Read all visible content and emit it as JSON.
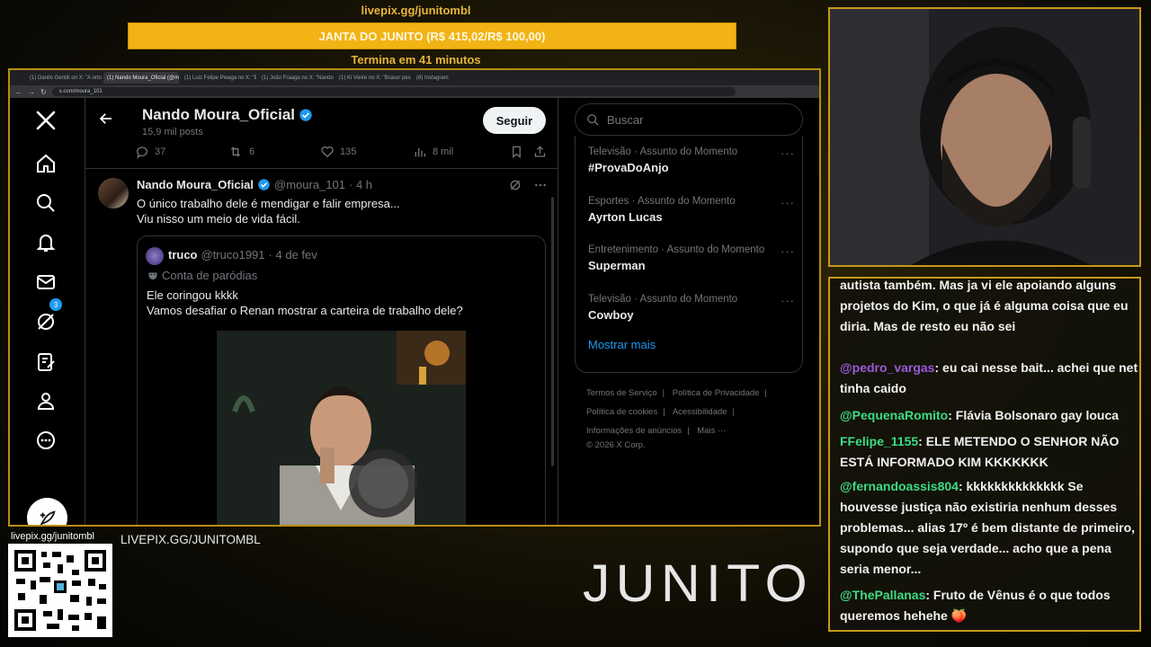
{
  "overlay": {
    "pix_url": "livepix.gg/junitombl",
    "goal_text": "JANTA DO JUNITO (R$ 415,02/R$ 100,00)",
    "goal_timer": "Termina em 41 minutos",
    "qr_label": "livepix.gg/junitombl",
    "pix_bottom": "LIVEPIX.GG/JUNITOMBL",
    "logo_text": "JUNITO"
  },
  "browser": {
    "tabs": [
      {
        "label": "(1) Danilo Gentili on X: \"A orto",
        "active": false
      },
      {
        "label": "(1) Nando Moura_Oficial (@mo",
        "active": true
      },
      {
        "label": "(1) Luiz Felipe Pwaga no X: \"B",
        "active": false
      },
      {
        "label": "(1) João Fraaga no X: \"Nando",
        "active": false
      },
      {
        "label": "(1) Ki Vieire no X: \"Brasor pes",
        "active": false
      },
      {
        "label": "(8) Instagram",
        "active": false
      }
    ],
    "url": "x.com/moura_101"
  },
  "sidebar": {
    "notifications_badge": "3"
  },
  "profile": {
    "name": "Nando Moura_Oficial",
    "posts_count": "15,9 mil posts",
    "follow_label": "Seguir"
  },
  "prev_actions": {
    "replies": "37",
    "reposts": "6",
    "likes": "135",
    "views": "8 mil"
  },
  "tweet": {
    "name": "Nando Moura_Oficial",
    "handle": "@moura_101",
    "time": "· 4 h",
    "line1": "O único trabalho dele é mendigar e falir empresa...",
    "line2": "Viu nisso um meio de vida fácil."
  },
  "quote": {
    "name": "truco",
    "handle": "@truco1991",
    "date": "· 4 de fev",
    "parody_label": "Conta de paródias",
    "line1": "Ele coringou kkkk",
    "line2": "Vamos desafiar o Renan mostrar a carteira de trabalho dele?"
  },
  "right": {
    "search_placeholder": "Buscar",
    "trends": [
      {
        "meta": "Televisão · Assunto do Momento",
        "title": "#ProvaDoAnjo"
      },
      {
        "meta": "Esportes · Assunto do Momento",
        "title": "Ayrton Lucas"
      },
      {
        "meta": "Entretenimento · Assunto do Momento",
        "title": "Superman"
      },
      {
        "meta": "Televisão · Assunto do Momento",
        "title": "Cowboy"
      }
    ],
    "show_more": "Mostrar mais",
    "footer": {
      "terms": "Termos de Serviço",
      "privacy": "Política de Privacidade",
      "cookies": "Política de cookies",
      "accessibility": "Acessibilidade",
      "ads": "Informações de anúncios",
      "more": "Mais ···",
      "copyright": "© 2026 X Corp."
    }
  },
  "chat": {
    "messages": [
      {
        "user": "",
        "color": "#f1f1f1",
        "text": "autista também. Mas ja vi ele apoiando alguns projetos do Kim, o que já é alguma coisa que eu diria. Mas de resto eu não sei"
      },
      {
        "user": "@pedro_vargas",
        "color": "#9b59d9",
        "text": ": eu cai nesse bait... achei que net tinha caido"
      },
      {
        "user": "@PequenaRomito",
        "color": "#3ddc84",
        "text": ": Flávia Bolsonaro gay louca"
      },
      {
        "user": "FFelipe_1155",
        "color": "#3ddc84",
        "text": ": ELE METENDO O SENHOR NÃO ESTÁ INFORMADO KIM KKKKKKK"
      },
      {
        "user": "@fernandoassis804",
        "color": "#3ddc84",
        "text": ": kkkkkkkkkkkkkk Se houvesse justiça não existiria nenhum desses problemas... alias 17º é bem distante de primeiro, supondo que seja verdade... acho que a pena seria menor..."
      },
      {
        "user": "@ThePallanas",
        "color": "#3ddc84",
        "text": ": Fruto de Vênus é o que todos queremos hehehe 🍑"
      }
    ]
  },
  "colors": {
    "accent": "#1d9bf0",
    "gold": "#c9981a",
    "goal": "#f2b315"
  }
}
